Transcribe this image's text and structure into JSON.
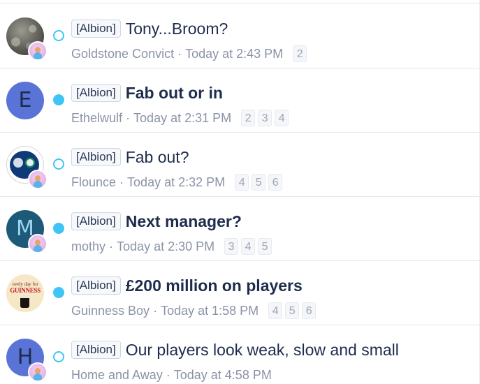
{
  "threads": [
    {
      "avatar_type": "image",
      "avatar_desc": "rock-avatar",
      "has_mini_avatar": true,
      "status": "read",
      "prefix": "[Albion]",
      "title": "Tony...Broom?",
      "bold": false,
      "author": "Goldstone Convict",
      "time": "Today at 2:43 PM",
      "pages": [
        "2"
      ]
    },
    {
      "avatar_type": "letter",
      "avatar_letter": "E",
      "avatar_color": "#5a73d6",
      "has_mini_avatar": false,
      "status": "unread",
      "prefix": "[Albion]",
      "title": "Fab out or in",
      "bold": true,
      "author": "Ethelwulf",
      "time": "Today at 2:31 PM",
      "pages": [
        "2",
        "3",
        "4"
      ]
    },
    {
      "avatar_type": "image",
      "avatar_desc": "badge-avatar",
      "has_mini_avatar": true,
      "status": "read",
      "prefix": "[Albion]",
      "title": "Fab out?",
      "bold": false,
      "author": "Flounce",
      "time": "Today at 2:32 PM",
      "pages": [
        "4",
        "5",
        "6"
      ]
    },
    {
      "avatar_type": "letter",
      "avatar_letter": "M",
      "avatar_color": "#1d5a78",
      "has_mini_avatar": true,
      "status": "unread",
      "prefix": "[Albion]",
      "title": "Next manager?",
      "bold": true,
      "author": "mothy",
      "time": "Today at 2:30 PM",
      "pages": [
        "3",
        "4",
        "5"
      ]
    },
    {
      "avatar_type": "image",
      "avatar_desc": "guinness-avatar",
      "avatar_text_top": "ovely day for",
      "avatar_text_brand": "GUINNESS",
      "has_mini_avatar": false,
      "status": "unread",
      "prefix": "[Albion]",
      "title": "£200 million on players",
      "bold": true,
      "author": "Guinness Boy",
      "time": "Today at 1:58 PM",
      "pages": [
        "4",
        "5",
        "6"
      ]
    },
    {
      "avatar_type": "letter",
      "avatar_letter": "H",
      "avatar_color": "#5a73d6",
      "has_mini_avatar": true,
      "status": "read",
      "prefix": "[Albion]",
      "title": "Our players look weak, slow and small",
      "bold": false,
      "author": "Home and Away",
      "time": "Today at 4:58 PM",
      "pages": []
    }
  ],
  "separator": "·",
  "colors": {
    "accent": "#3fc5f5",
    "title": "#1e2c4d",
    "meta": "#8a93a6"
  }
}
